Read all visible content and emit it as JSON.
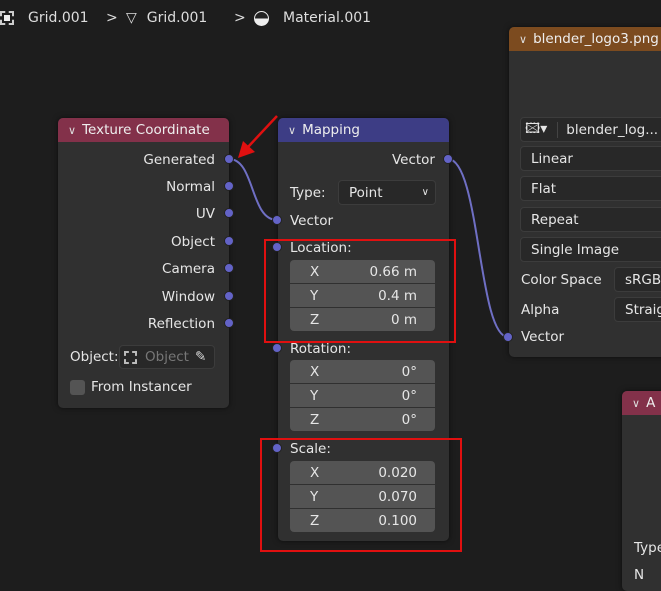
{
  "breadcrumb": {
    "object": "Grid.001",
    "mesh": "Grid.001",
    "material": "Material.001",
    "separator": ">"
  },
  "texture_coordinate": {
    "title": "Texture Coordinate",
    "outputs": [
      "Generated",
      "Normal",
      "UV",
      "Object",
      "Camera",
      "Window",
      "Reflection"
    ],
    "object_label": "Object:",
    "object_placeholder": "Object",
    "from_instancer": "From Instancer",
    "header_color": "#83314a"
  },
  "mapping": {
    "title": "Mapping",
    "output": "Vector",
    "type_label": "Type:",
    "type_value": "Point",
    "input_vector": "Vector",
    "location": {
      "label": "Location:",
      "x": "0.66 m",
      "y": "0.4 m",
      "z": "0 m"
    },
    "rotation": {
      "label": "Rotation:",
      "x": "0°",
      "y": "0°",
      "z": "0°"
    },
    "scale": {
      "label": "Scale:",
      "x": "0.020",
      "y": "0.070",
      "z": "0.100"
    },
    "axes": [
      "X",
      "Y",
      "Z"
    ],
    "header_color": "#3d3d85"
  },
  "image_texture": {
    "title": "blender_logo3.png",
    "image_name": "blender_log...",
    "interpolation": "Linear",
    "projection": "Flat",
    "extension": "Repeat",
    "source": "Single Image",
    "color_space_label": "Color Space",
    "color_space": "sRGB",
    "alpha_label": "Alpha",
    "alpha": "Straig",
    "input_vector": "Vector",
    "header_color": "#7c4b1f"
  },
  "partial_node": {
    "title": "A",
    "type_label": "Type",
    "next_label": "N"
  },
  "colors": {
    "socket": "#6363c7",
    "annotation": "#e01010"
  }
}
